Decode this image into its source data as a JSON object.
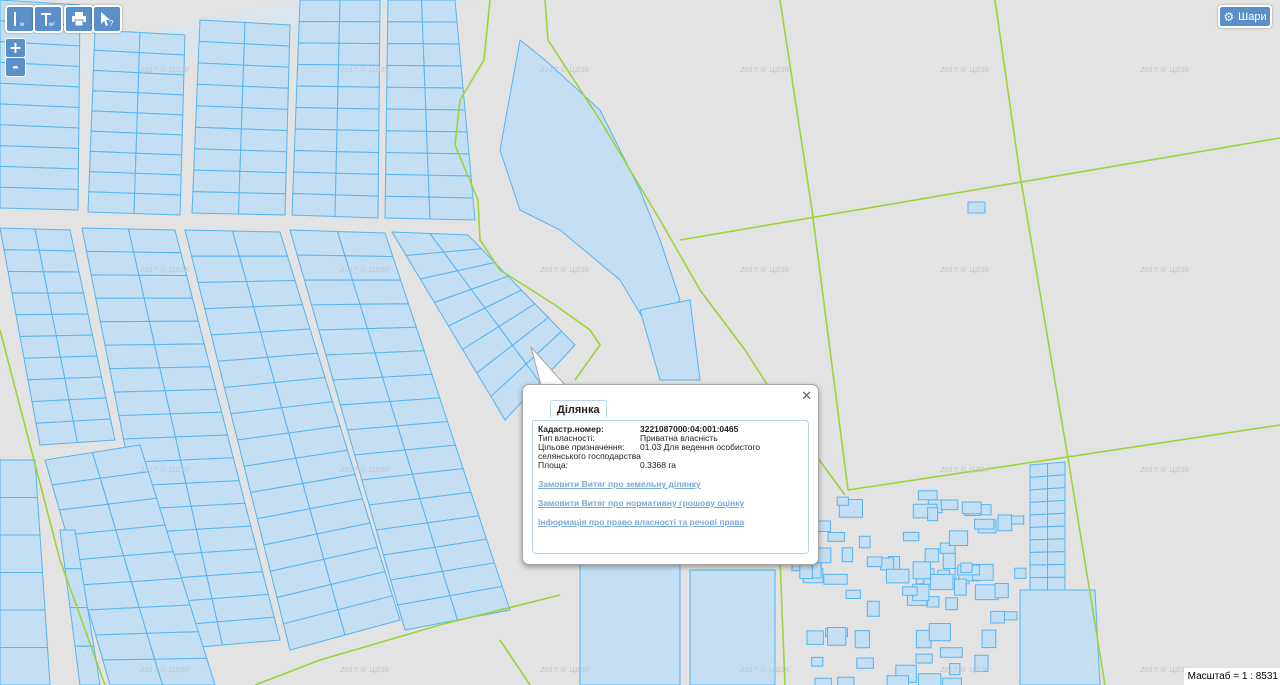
{
  "toolbar": {
    "measure_length_icon": "ruler-line-icon",
    "measure_area_icon": "ruler-area-icon",
    "print_icon": "printer-icon",
    "identify_icon": "cursor-question-icon"
  },
  "zoom": {
    "in_label": "+",
    "out_label": "-"
  },
  "layers_button": {
    "label": "Шари",
    "icon": "gear-icon"
  },
  "watermark_text": "2017 © ЦДЗК",
  "popup": {
    "tab_label": "Ділянка",
    "rows": [
      {
        "key": "Кадастр.номер:",
        "value": "3221087000:04:001:0465"
      },
      {
        "key": "Тип власності:",
        "value": "Приватна власність"
      },
      {
        "key": "Цільове призначення:",
        "value": "01.03 Для ведення особистого"
      },
      {
        "key": "селянського господарства",
        "value": ""
      },
      {
        "key": "Площа:",
        "value": "0.3368 га"
      }
    ],
    "links": [
      "Замовити Витяг про земельну ділянку",
      "Замовити Витяг про нормативну грошову оцінку",
      "Інформація про право власності та речові права"
    ]
  },
  "scale_label": "Масштаб = 1 : 8531",
  "colors": {
    "background": "#e3e3e3",
    "parcel_fill": "#c4dff4",
    "parcel_stroke": "#56b4f0",
    "boundary": "#9dd33a",
    "button": "#5a8fc9"
  }
}
